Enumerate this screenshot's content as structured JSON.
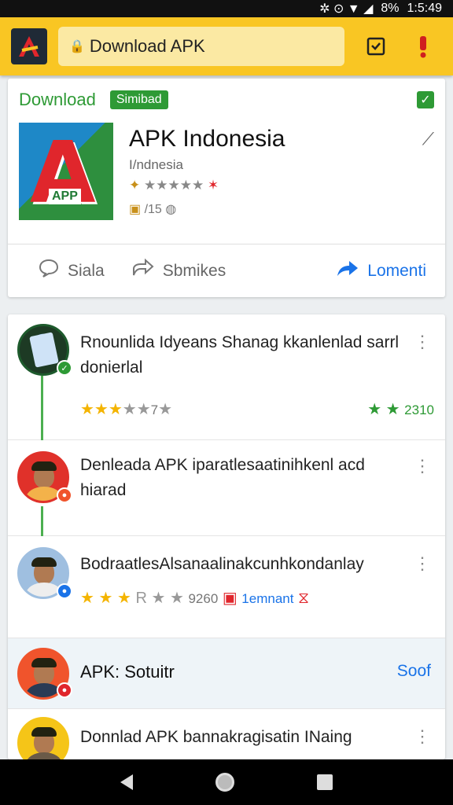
{
  "status_bar": {
    "icons": "✲ ⊙ ▼ ◢",
    "battery": "8%",
    "time": "1:5:49"
  },
  "toolbar": {
    "address": "Download APK",
    "icons": [
      "extension-icon",
      "alert-icon"
    ]
  },
  "app_card": {
    "heading": "Download",
    "badge": "Simibad",
    "app_name": "APK Indonesia",
    "subtitle": "I/ndnesia",
    "rating_stars": "★★★★★",
    "size_info": "/15",
    "icon_letter": "A",
    "icon_tag": "APP",
    "actions": {
      "share": "Siala",
      "bookmarks": "Sbmikes",
      "comment": "Lomenti"
    }
  },
  "feed": {
    "items": [
      {
        "text": "Rnounlida Idyeans Shanag kkanlenlad sarrl donierlal",
        "stars_filled": 3,
        "stars_gray": 2,
        "stars_note": "7",
        "right_rating": "2310"
      },
      {
        "text": "Denleada APK iparatlesaatinihkenl acd hiarad"
      },
      {
        "text": "BodraatlesAlsanaalinakcunhkondanlay",
        "stars_filled": 3,
        "stars_note": "R",
        "stars_count": "9260",
        "badge_text": "1emnant"
      },
      {
        "title": "APK: Sotuitr",
        "link": "Soof"
      },
      {
        "text": "Donnlad APK bannakragisatin INaing"
      }
    ]
  },
  "colors": {
    "accent": "#f9c623",
    "green": "#2e9a35",
    "blue": "#1a73e8"
  }
}
